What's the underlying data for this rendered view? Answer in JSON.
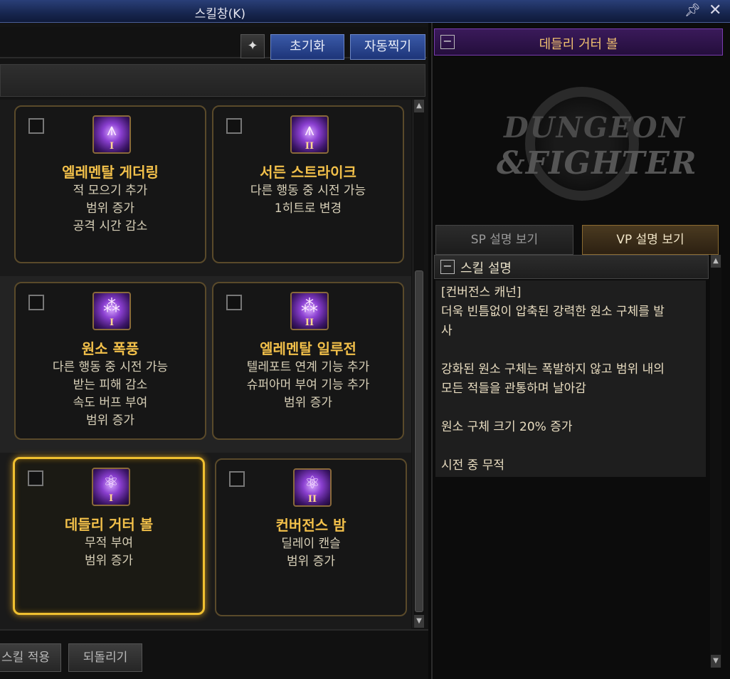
{
  "window": {
    "title": "스킬창(K)",
    "pin_icon": "pin-icon",
    "close_icon": "close-icon"
  },
  "toolbar": {
    "tool_icon": "skill-tool-icon",
    "reset_label": "초기화",
    "auto_label": "자동찍기"
  },
  "cards": [
    {
      "name": "엘레멘탈 게더링",
      "tier": "I",
      "icon": "gathering-icon",
      "selected": false,
      "lines": [
        "적 모으기 추가",
        "범위 증가",
        "공격 시간 감소"
      ]
    },
    {
      "name": "서든 스트라이크",
      "tier": "II",
      "icon": "gathering-icon",
      "selected": false,
      "lines": [
        "다른 행동 중 시전 가능",
        "1히트로 변경",
        ""
      ]
    },
    {
      "name": "원소 폭풍",
      "tier": "I",
      "icon": "storm-icon",
      "selected": false,
      "lines": [
        "다른 행동 중 시전 가능",
        "받는 피해 감소",
        "속도 버프 부여",
        "범위 증가"
      ]
    },
    {
      "name": "엘레멘탈 일루전",
      "tier": "II",
      "icon": "storm-icon",
      "selected": false,
      "lines": [
        "텔레포트 연계 기능 추가",
        "슈퍼아머 부여 기능 추가",
        "범위 증가",
        ""
      ]
    },
    {
      "name": "데들리 거터 볼",
      "tier": "I",
      "icon": "orb-icon",
      "selected": true,
      "lines": [
        "무적 부여",
        "범위 증가"
      ]
    },
    {
      "name": "컨버전스 밤",
      "tier": "II",
      "icon": "orb-icon",
      "selected": false,
      "lines": [
        "딜레이 캔슬",
        "범위 증가"
      ]
    }
  ],
  "bottom": {
    "apply_label": "스킬 적용",
    "undo_label": "되돌리기"
  },
  "detail": {
    "header": "데들리 거터 볼",
    "logo_line1": "DUNGEON",
    "logo_line2": "&FIGHTER",
    "tab_sp": "SP 설명 보기",
    "tab_vp": "VP 설명 보기",
    "section_label": "스킬 설명",
    "lines": [
      "[컨버전스 캐넌]",
      "더욱 빈틈없이 압축된 강력한 원소 구체를 발",
      "사",
      "",
      "강화된 원소 구체는 폭발하지 않고 범위 내의",
      "모든 적들을 관통하며 날아감",
      "",
      "원소 구체 크기 20% 증가",
      "",
      "시전 중 무적"
    ]
  },
  "colors": {
    "accent_gold": "#f0c030",
    "skill_name": "#f2c04a",
    "header_purple": "#7a3cb0",
    "button_blue": "#3a5aa8"
  }
}
